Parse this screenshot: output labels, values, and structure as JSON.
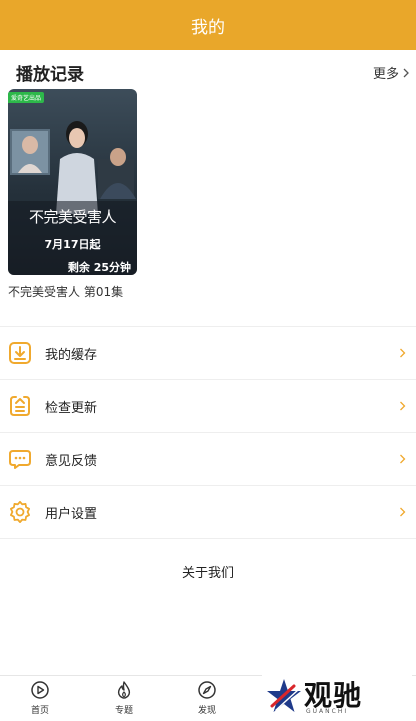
{
  "header": {
    "title": "我的"
  },
  "history": {
    "section_title": "播放记录",
    "more_label": "更多",
    "item": {
      "badge": "爱奇艺出品",
      "poster_title": "不完美受害人",
      "poster_date": "7月17日起",
      "remaining": "剩余 25分钟",
      "caption": "不完美受害人 第01集"
    }
  },
  "menu": [
    {
      "label": "我的缓存",
      "icon": "download-icon"
    },
    {
      "label": "检查更新",
      "icon": "update-icon"
    },
    {
      "label": "意见反馈",
      "icon": "feedback-icon"
    },
    {
      "label": "用户设置",
      "icon": "settings-icon"
    }
  ],
  "about_label": "关于我们",
  "bottom_nav": [
    {
      "label": "首页",
      "icon": "play-circle-icon"
    },
    {
      "label": "专题",
      "icon": "flame-icon"
    },
    {
      "label": "发现",
      "icon": "compass-icon"
    }
  ],
  "watermark": {
    "text": "观驰",
    "sub": "GUANCHI"
  },
  "colors": {
    "accent": "#e9a72a",
    "icon": "#f0a92e"
  }
}
